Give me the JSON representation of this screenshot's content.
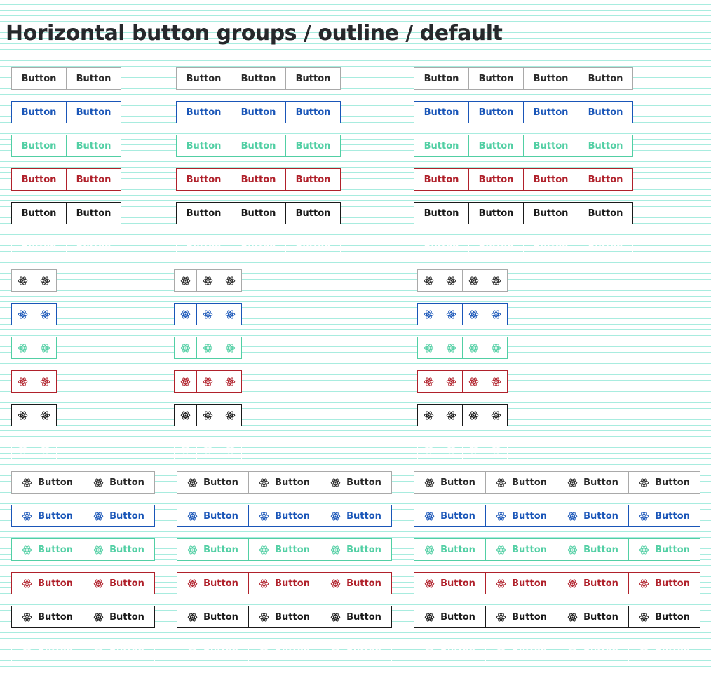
{
  "page": {
    "title": "Horizontal button groups / outline / default"
  },
  "button_label": "Button",
  "icon": "atom-icon",
  "group_sizes": [
    2,
    3,
    4
  ],
  "colors": {
    "gray": "#a9a9a9",
    "blue": "#1a56b8",
    "teal": "#52cfa4",
    "red": "#b0212b",
    "black": "#1a1a1a",
    "white": "#ffffff",
    "grid_line": "#a8ecdf"
  },
  "variants": [
    "gray",
    "blue",
    "teal",
    "red",
    "black",
    "white"
  ],
  "sections": [
    {
      "name": "text-only"
    },
    {
      "name": "icon-only"
    },
    {
      "name": "icon-and-text"
    }
  ]
}
